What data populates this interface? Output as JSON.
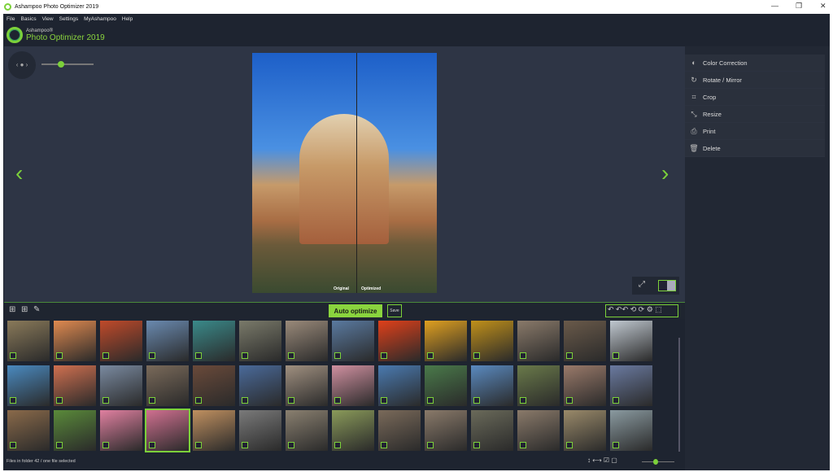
{
  "window": {
    "title": "Ashampoo Photo Optimizer 2019",
    "minimize": "—",
    "maximize": "❐",
    "close": "✕"
  },
  "menu": [
    "File",
    "Basics",
    "View",
    "Settings",
    "MyAshampoo",
    "Help"
  ],
  "logo": {
    "brand": "Ashampoo®",
    "product": "Photo Optimizer 2019"
  },
  "preview": {
    "original_label": "Original",
    "optimized_label": "Optimized"
  },
  "tools": [
    {
      "icon": "◐",
      "label": "Color Correction"
    },
    {
      "icon": "↻",
      "label": "Rotate / Mirror"
    },
    {
      "icon": "⌗",
      "label": "Crop"
    },
    {
      "icon": "⤡",
      "label": "Resize"
    },
    {
      "icon": "⎙",
      "label": "Print"
    },
    {
      "icon": "🗑",
      "label": "Delete"
    }
  ],
  "toolbar": {
    "auto_optimize": "Auto optimize",
    "save": "Save",
    "undo_icons": "↶ ↶↶ ⟲ ⟳ ⚙ ⬚"
  },
  "thumbs": [
    "#8a7a5a",
    "#e08a50",
    "#c04a2a",
    "#6a8ab0",
    "#3a8a8a",
    "#7a7a6a",
    "#9a8a7a",
    "#5a7aa0",
    "#e0401a",
    "#e0a020",
    "#c0901a",
    "#8a7a6a",
    "#6a5a4a",
    "#c0c8d0",
    "#4a8ac0",
    "#d07050",
    "#7a8aa0",
    "#7a6a5a",
    "#6a4a3a",
    "#4a6a9a",
    "#a09080",
    "#d090a0",
    "#4a7ab0",
    "#4a7a4a",
    "#5a8ac0",
    "#6a7a4a",
    "#9a7a6a",
    "#6a7aa0",
    "#8a6a4a",
    "#5a8a3a",
    "#e080a0",
    "#d07090",
    "#c09060",
    "#7a7a7a",
    "#8a8070",
    "#8a9a5a",
    "#7a6a5a",
    "#8a7a6a",
    "#6a6a5a",
    "#8a7a6a",
    "#9a8a6a",
    "#8a9aa0"
  ],
  "selected_index": 31,
  "status": "Files in folder 42 / one file selected"
}
